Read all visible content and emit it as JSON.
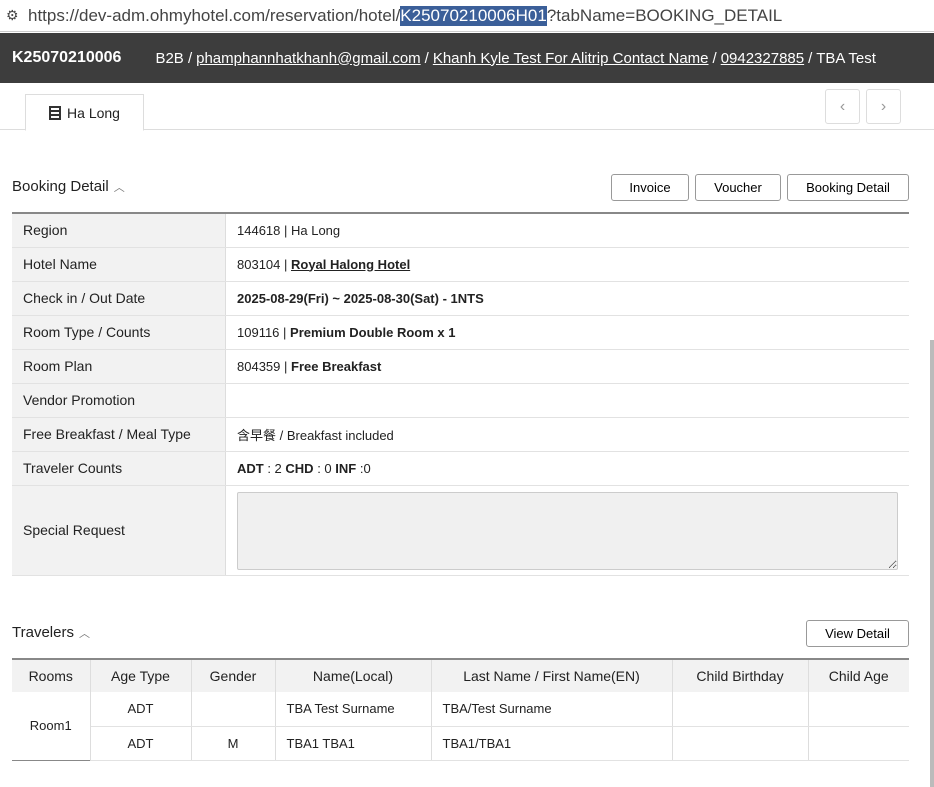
{
  "url": {
    "prefix": "https://dev-adm.ohmyhotel.com/reservation/hotel/",
    "selected": "K25070210006H01",
    "suffix": "?tabName=BOOKING_DETAIL"
  },
  "header": {
    "booking_no": "K25070210006",
    "channel": "B2B /",
    "email": "phamphannhatkhanh@gmail.com",
    "contact": "Khanh Kyle Test For Alitrip Contact Name",
    "phone": "0942327885",
    "traveler": "/ TBA Test"
  },
  "tab": {
    "label": "Ha Long"
  },
  "booking": {
    "title": "Booking Detail",
    "buttons": {
      "invoice": "Invoice",
      "voucher": "Voucher",
      "detail": "Booking Detail"
    },
    "rows": {
      "region_label": "Region",
      "region_value": "144618 | Ha Long",
      "hotel_label": "Hotel Name",
      "hotel_code": "803104 |",
      "hotel_name": "Royal Halong Hotel",
      "date_label": "Check in / Out Date",
      "date_value": "2025-08-29(Fri) ~ 2025-08-30(Sat) - 1NTS",
      "room_label": "Room Type / Counts",
      "room_code": "109116 |",
      "room_name": "Premium Double Room x 1",
      "plan_label": "Room Plan",
      "plan_code": "804359 |",
      "plan_name": "Free Breakfast",
      "promo_label": "Vendor Promotion",
      "meal_label": "Free Breakfast / Meal Type",
      "meal_value": "含早餐 / Breakfast included",
      "count_label": "Traveler Counts",
      "adt": "ADT",
      "adt_n": " : 2 ",
      "chd": "CHD",
      "chd_n": " : 0 ",
      "inf": "INF",
      "inf_n": " :0",
      "request_label": "Special Request"
    }
  },
  "travelers": {
    "title": "Travelers",
    "view_detail": "View Detail",
    "headers": [
      "Rooms",
      "Age Type",
      "Gender",
      "Name(Local)",
      "Last Name / First Name(EN)",
      "Child Birthday",
      "Child Age"
    ],
    "room": "Room1",
    "rows": [
      {
        "age": "ADT",
        "gender": "",
        "local": "TBA Test Surname",
        "en": "TBA/Test Surname"
      },
      {
        "age": "ADT",
        "gender": "M",
        "local": "TBA1 TBA1",
        "en": "TBA1/TBA1"
      }
    ]
  }
}
